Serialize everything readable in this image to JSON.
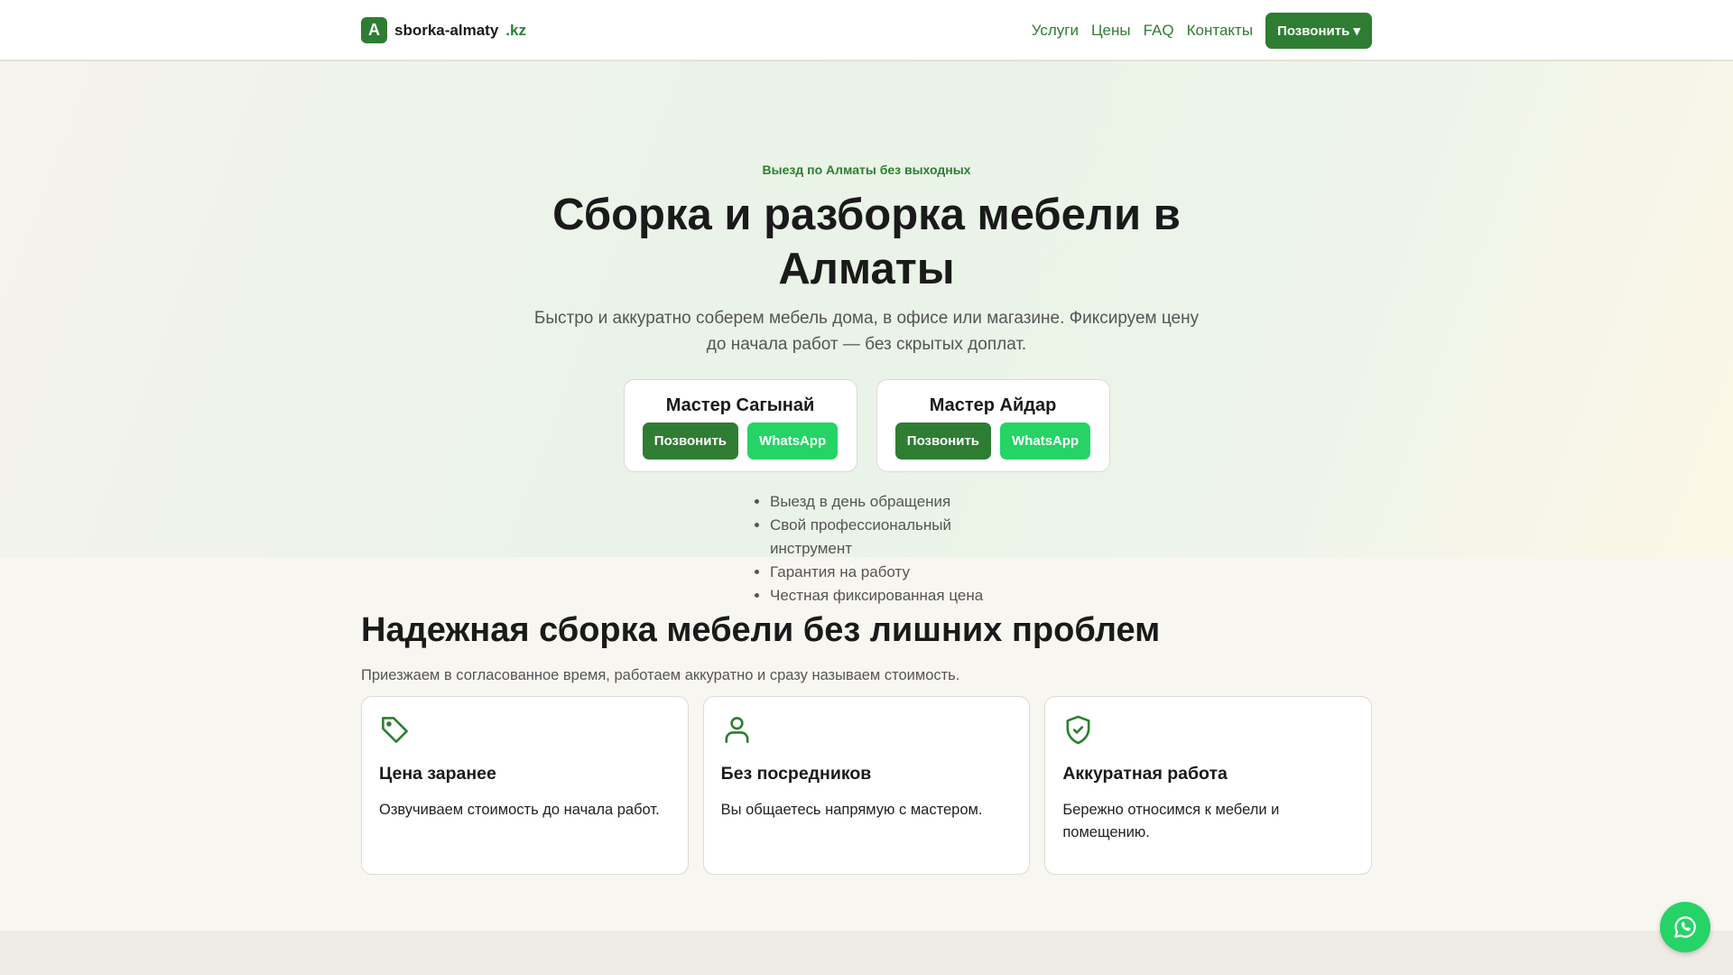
{
  "header": {
    "logo_letter": "A",
    "brand": "sborka-almaty",
    "tld": ".kz",
    "nav": [
      "Услуги",
      "Цены",
      "FAQ",
      "Контакты"
    ],
    "call_button": "Позвонить ▾"
  },
  "hero": {
    "badge": "Выезд по Алматы без выходных",
    "title": "Сборка и разборка мебели в Алматы",
    "subtitle": "Быстро и аккуратно соберем мебель дома, в офисе или магазине. Фиксируем цену до начала работ — без скрытых доплат.",
    "masters": [
      {
        "name": "Мастер Сагынай",
        "call": "Позвонить",
        "whatsapp": "WhatsApp"
      },
      {
        "name": "Мастер Айдар",
        "call": "Позвонить",
        "whatsapp": "WhatsApp"
      }
    ],
    "bullets": [
      "Выезд в день обращения",
      "Свой профессиональный инструмент",
      "Гарантия на работу",
      "Честная фиксированная цена"
    ]
  },
  "features": {
    "title": "Надежная сборка мебели без лишних проблем",
    "subtitle": "Приезжаем в согласованное время, работаем аккуратно и сразу называем стоимость.",
    "cards": [
      {
        "icon": "tag-icon",
        "title": "Цена заранее",
        "desc": "Озвучиваем стоимость до начала работ."
      },
      {
        "icon": "user-icon",
        "title": "Без посредников",
        "desc": "Вы общаетесь напрямую с мастером."
      },
      {
        "icon": "shield-check-icon",
        "title": "Аккуратная работа",
        "desc": "Бережно относимся к мебели и помещению."
      }
    ]
  },
  "colors": {
    "primary": "#2e7d32",
    "whatsapp": "#25d366"
  }
}
